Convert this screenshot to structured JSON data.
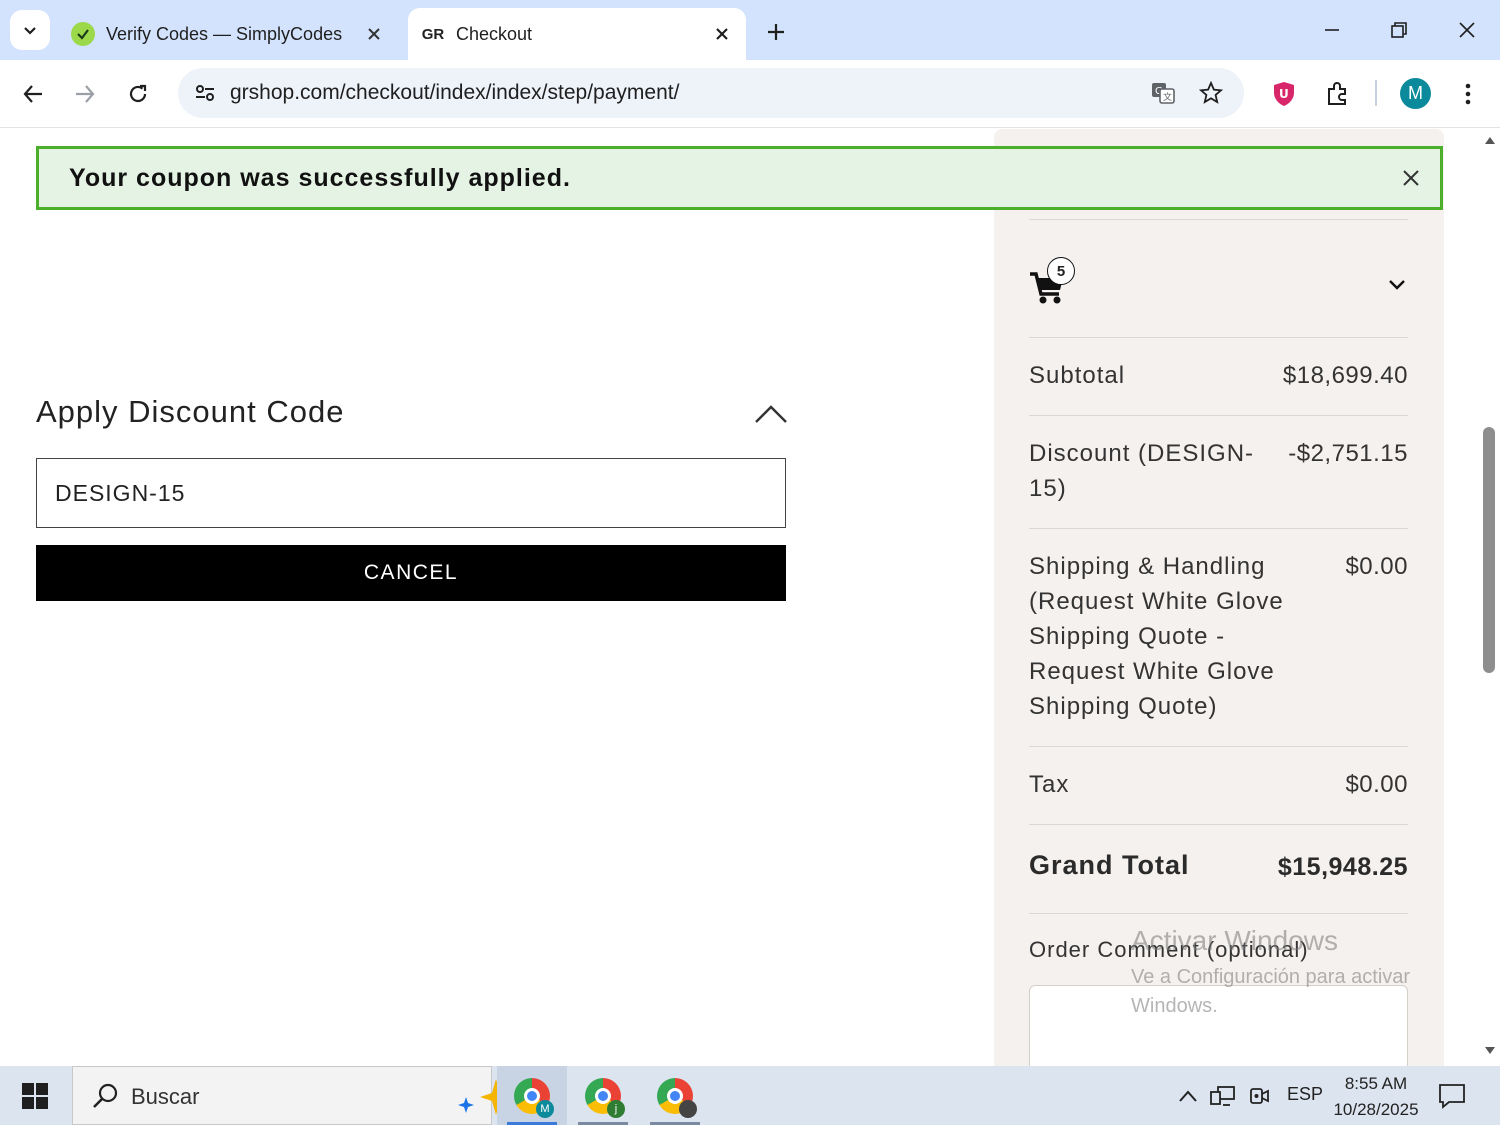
{
  "browser": {
    "tabs": [
      {
        "title": "Verify Codes — SimplyCodes",
        "favicon": "simplycodes-icon",
        "active": false
      },
      {
        "title": "Checkout",
        "favicon_text": "GR",
        "active": true
      }
    ],
    "url": "grshop.com/checkout/index/index/step/payment/",
    "profile_initial": "M",
    "accent_color": "#d3e3fd"
  },
  "notice": {
    "message": "Your coupon was successfully applied.",
    "color": "#4caf2c"
  },
  "discount": {
    "title": "Apply Discount Code",
    "code_value": "DESIGN-15",
    "cancel_label": "CANCEL"
  },
  "summary": {
    "cart_count": "5",
    "rows": [
      {
        "label": "Subtotal",
        "value": "$18,699.40"
      },
      {
        "label": "Discount (DESIGN-\n15)",
        "value": "-$2,751.15"
      },
      {
        "label": "Shipping & Handling\n(Request White Glove\nShipping Quote -\nRequest White Glove\nShipping Quote)",
        "value": "$0.00"
      },
      {
        "label": "Tax",
        "value": "$0.00"
      }
    ],
    "grand_total_label": "Grand Total",
    "grand_total_value": "$15,948.25",
    "comment_label": "Order Comment (optional)"
  },
  "watermark": {
    "line1": "Activar Windows",
    "line2": "Ve a Configuración para activar Windows."
  },
  "taskbar": {
    "search_placeholder": "Buscar",
    "language": "ESP",
    "time": "8:55 AM",
    "date": "10/28/2025",
    "apps": [
      {
        "name": "chrome-profile-m",
        "badge": "M",
        "badge_color": "#0b8a9c",
        "active": true
      },
      {
        "name": "chrome-profile-j",
        "badge": "j",
        "badge_color": "#2e7d32",
        "active": false
      },
      {
        "name": "chrome-profile-photo",
        "badge": "",
        "badge_color": "#444444",
        "active": false
      }
    ]
  }
}
